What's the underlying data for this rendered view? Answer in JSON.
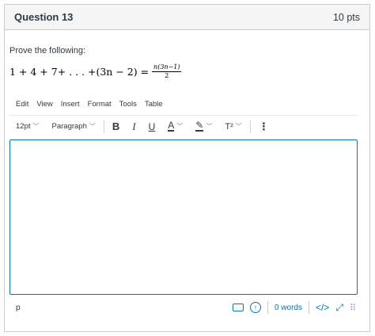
{
  "question": {
    "title": "Question 13",
    "points": "10 pts",
    "prompt": "Prove the following:",
    "formula_lhs": "1 + 4 + 7+ . . . +(3n − 2) =",
    "formula_num": "n(3n−1)",
    "formula_den": "2"
  },
  "menu": {
    "edit": "Edit",
    "view": "View",
    "insert": "Insert",
    "format": "Format",
    "tools": "Tools",
    "table": "Table"
  },
  "toolbar": {
    "font_size": "12pt",
    "paragraph": "Paragraph",
    "bold": "B",
    "italic": "I",
    "underline": "U",
    "text_color": "A",
    "highlight": "✎",
    "superscript": "T²",
    "more": "⋮"
  },
  "editor": {
    "content": ""
  },
  "status": {
    "path": "p",
    "word_count": "0 words",
    "html_toggle": "</>"
  },
  "colors": {
    "accent": "#0374b5",
    "text": "#2d3b45",
    "border": "#c7cdd1"
  }
}
